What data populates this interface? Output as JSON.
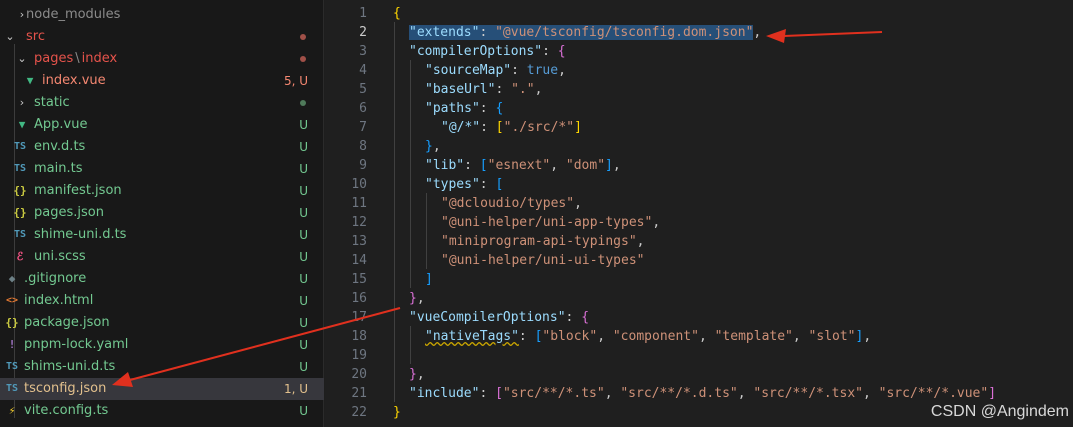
{
  "explorer": {
    "items": [
      {
        "label": "node_modules",
        "status": ""
      },
      {
        "label": "src",
        "status": ""
      },
      {
        "label_a": "pages",
        "sep": "\\",
        "label_b": "index",
        "status": ""
      },
      {
        "label": "index.vue",
        "status": "5, U"
      },
      {
        "label": "static",
        "status": ""
      },
      {
        "label": "App.vue",
        "status": "U"
      },
      {
        "label": "env.d.ts",
        "status": "U"
      },
      {
        "label": "main.ts",
        "status": "U"
      },
      {
        "label": "manifest.json",
        "status": "U"
      },
      {
        "label": "pages.json",
        "status": "U"
      },
      {
        "label": "shime-uni.d.ts",
        "status": "U"
      },
      {
        "label": "uni.scss",
        "status": "U"
      },
      {
        "label": ".gitignore",
        "status": "U"
      },
      {
        "label": "index.html",
        "status": "U"
      },
      {
        "label": "package.json",
        "status": "U"
      },
      {
        "label": "pnpm-lock.yaml",
        "status": "U"
      },
      {
        "label": "shims-uni.d.ts",
        "status": "U"
      },
      {
        "label": "tsconfig.json",
        "status": "1, U"
      },
      {
        "label": "vite.config.ts",
        "status": "U"
      }
    ],
    "icons": {
      "ts": "TS",
      "json": "{}",
      "vue": "▼",
      "git": "◆",
      "html": "<>",
      "yaml": "!",
      "scss": "ℰ",
      "config": "⚡",
      "chevron_down": "⌄",
      "chevron_right": "›"
    },
    "colors": {
      "untracked": "#73c991",
      "error": "#f48771",
      "modified_file": "#e2c08d",
      "folder_modified": "#e5534b"
    }
  },
  "editor": {
    "lines": [
      {
        "n": "1",
        "t": [
          [
            "b1",
            "{"
          ]
        ]
      },
      {
        "n": "2",
        "t": [
          [
            "key",
            "\"extends\""
          ],
          [
            "p",
            ": "
          ],
          [
            "str",
            "\"@vue/tsconfig/tsconfig.dom.json\""
          ],
          [
            "p",
            ","
          ]
        ]
      },
      {
        "n": "3",
        "t": [
          [
            "key",
            "\"compilerOptions\""
          ],
          [
            "p",
            ": "
          ],
          [
            "b2",
            "{"
          ]
        ]
      },
      {
        "n": "4",
        "t": [
          [
            "key",
            "\"sourceMap\""
          ],
          [
            "p",
            ": "
          ],
          [
            "kw",
            "true"
          ],
          [
            "p",
            ","
          ]
        ]
      },
      {
        "n": "5",
        "t": [
          [
            "key",
            "\"baseUrl\""
          ],
          [
            "p",
            ": "
          ],
          [
            "str",
            "\".\""
          ],
          [
            "p",
            ","
          ]
        ]
      },
      {
        "n": "6",
        "t": [
          [
            "key",
            "\"paths\""
          ],
          [
            "p",
            ": "
          ],
          [
            "b3",
            "{"
          ]
        ]
      },
      {
        "n": "7",
        "t": [
          [
            "key",
            "\"@/*\""
          ],
          [
            "p",
            ": "
          ],
          [
            "b1",
            "["
          ],
          [
            "str",
            "\"./src/*\""
          ],
          [
            "b1",
            "]"
          ]
        ]
      },
      {
        "n": "8",
        "t": [
          [
            "b3",
            "}"
          ],
          [
            "p",
            ","
          ]
        ]
      },
      {
        "n": "9",
        "t": [
          [
            "key",
            "\"lib\""
          ],
          [
            "p",
            ": "
          ],
          [
            "b3",
            "["
          ],
          [
            "str",
            "\"esnext\""
          ],
          [
            "p",
            ", "
          ],
          [
            "str",
            "\"dom\""
          ],
          [
            "b3",
            "]"
          ],
          [
            "p",
            ","
          ]
        ]
      },
      {
        "n": "10",
        "t": [
          [
            "key",
            "\"types\""
          ],
          [
            "p",
            ": "
          ],
          [
            "b3",
            "["
          ]
        ]
      },
      {
        "n": "11",
        "t": [
          [
            "str",
            "\"@dcloudio/types\""
          ],
          [
            "p",
            ","
          ]
        ]
      },
      {
        "n": "12",
        "t": [
          [
            "str",
            "\"@uni-helper/uni-app-types\""
          ],
          [
            "p",
            ","
          ]
        ]
      },
      {
        "n": "13",
        "t": [
          [
            "str",
            "\"miniprogram-api-typings\""
          ],
          [
            "p",
            ","
          ]
        ]
      },
      {
        "n": "14",
        "t": [
          [
            "str",
            "\"@uni-helper/uni-ui-types\""
          ]
        ]
      },
      {
        "n": "15",
        "t": [
          [
            "b3",
            "]"
          ]
        ]
      },
      {
        "n": "16",
        "t": [
          [
            "b2",
            "}"
          ],
          [
            "p",
            ","
          ]
        ]
      },
      {
        "n": "17",
        "t": [
          [
            "key",
            "\"vueCompilerOptions\""
          ],
          [
            "p",
            ": "
          ],
          [
            "b2",
            "{"
          ]
        ]
      },
      {
        "n": "18",
        "t": [
          [
            "key",
            "\"nativeTags\""
          ],
          [
            "p",
            ": "
          ],
          [
            "b3",
            "["
          ],
          [
            "str",
            "\"block\""
          ],
          [
            "p",
            ", "
          ],
          [
            "str",
            "\"component\""
          ],
          [
            "p",
            ", "
          ],
          [
            "str",
            "\"template\""
          ],
          [
            "p",
            ", "
          ],
          [
            "str",
            "\"slot\""
          ],
          [
            "b3",
            "]"
          ],
          [
            "p",
            ","
          ]
        ]
      },
      {
        "n": "19",
        "t": []
      },
      {
        "n": "20",
        "t": [
          [
            "b2",
            "}"
          ],
          [
            "p",
            ","
          ]
        ]
      },
      {
        "n": "21",
        "t": [
          [
            "key",
            "\"include\""
          ],
          [
            "p",
            ": "
          ],
          [
            "b2",
            "["
          ],
          [
            "str",
            "\"src/**/*.ts\""
          ],
          [
            "p",
            ", "
          ],
          [
            "str",
            "\"src/**/*.d.ts\""
          ],
          [
            "p",
            ", "
          ],
          [
            "str",
            "\"src/**/*.tsx\""
          ],
          [
            "p",
            ", "
          ],
          [
            "str",
            "\"src/**/*.vue\""
          ],
          [
            "b2",
            "]"
          ]
        ]
      },
      {
        "n": "22",
        "t": [
          [
            "b1",
            "}"
          ]
        ]
      }
    ],
    "active_line": "2",
    "colors": {
      "key": "#9cdcfe",
      "string": "#ce9178",
      "keyword": "#569cd6",
      "selection": "#264f78",
      "annotation_arrow": "#e0301e"
    }
  },
  "watermark": "CSDN @Angindem"
}
